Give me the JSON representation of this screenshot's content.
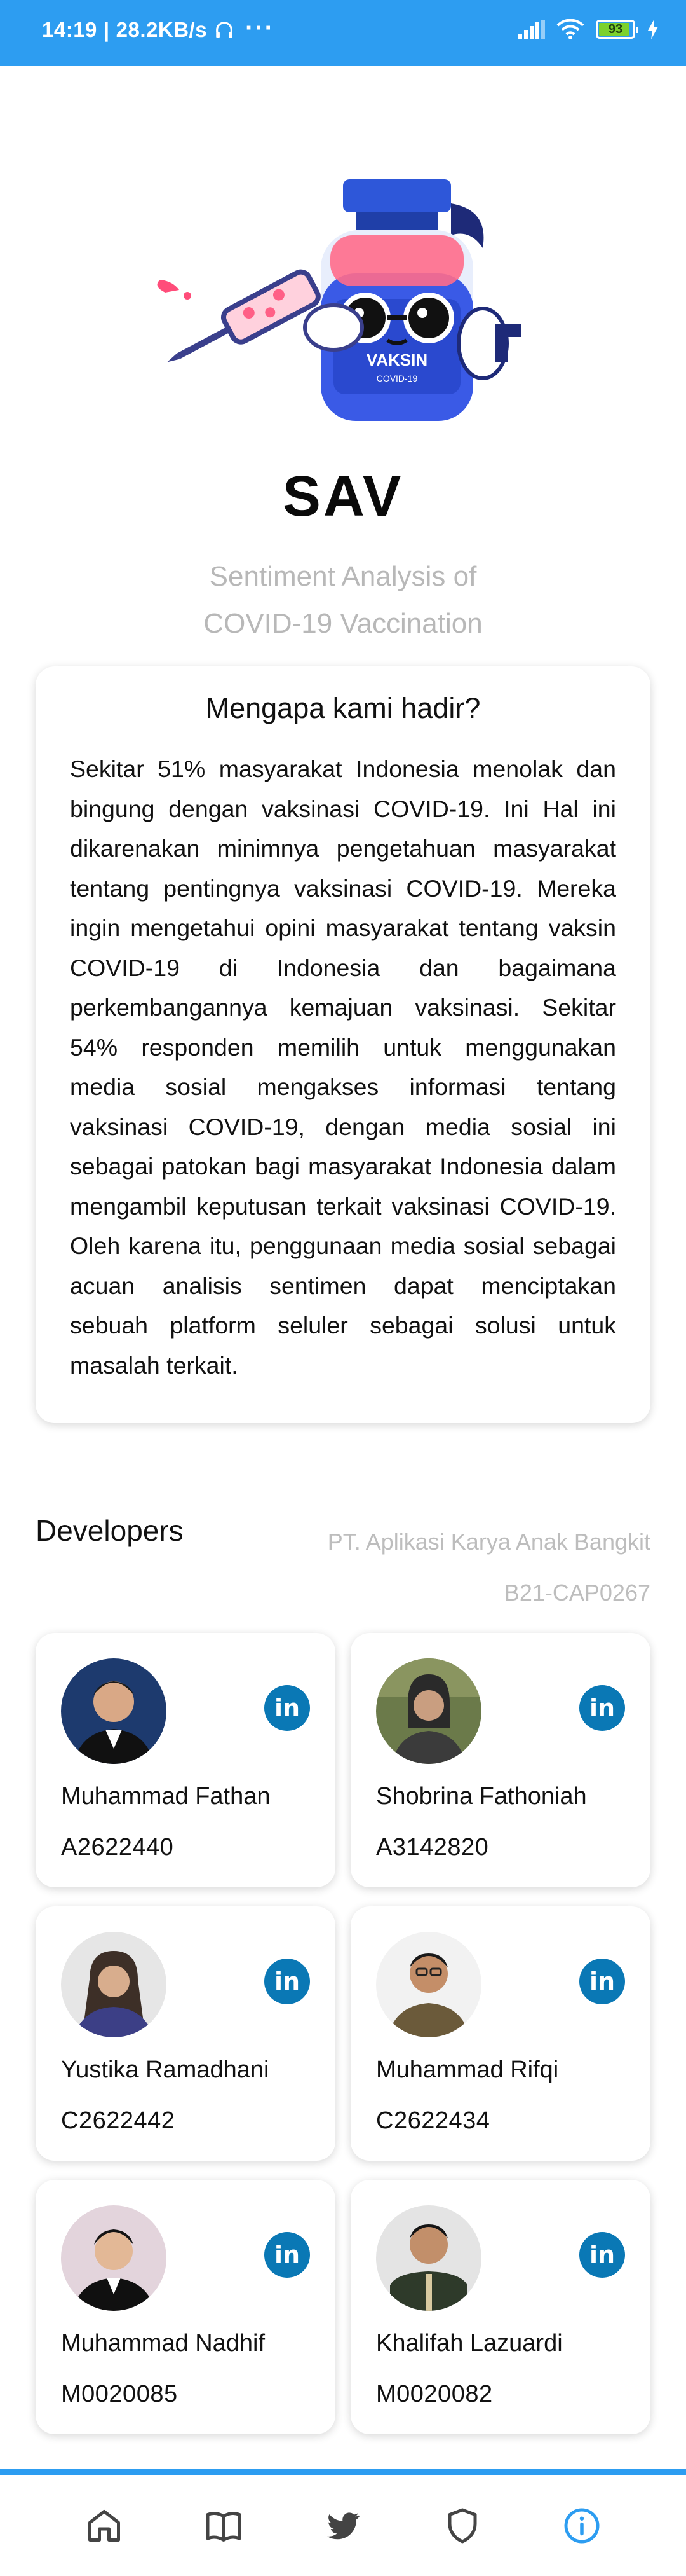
{
  "status_bar": {
    "time": "14:19",
    "net_speed": "28.2KB/s",
    "more": "···",
    "battery": "93"
  },
  "app": {
    "title": "SAV",
    "subtitle_line1": "Sentiment Analysis of",
    "subtitle_line2": "COVID-19 Vaccination",
    "mascot_label": "VAKSIN",
    "mascot_sublabel": "COVID-19"
  },
  "why": {
    "heading": "Mengapa kami hadir?",
    "body": "Sekitar 51% masyarakat Indonesia menolak dan bingung dengan vaksinasi COVID-19. Ini Hal ini dikarenakan minimnya pengetahuan masyarakat tentang pentingnya vaksinasi COVID-19. Mereka ingin mengetahui opini masyarakat tentang vaksin COVID-19 di Indonesia dan bagaimana perkembangannya kemajuan vaksinasi. Sekitar 54% responden memilih untuk menggunakan media sosial mengakses informasi tentang vaksinasi COVID-19, dengan media sosial ini sebagai patokan bagi masyarakat Indonesia dalam mengambil keputusan terkait vaksinasi COVID-19. Oleh karena itu, penggunaan media sosial sebagai acuan analisis sentimen dapat menciptakan sebuah platform seluler sebagai solusi untuk masalah terkait."
  },
  "developers": {
    "title": "Developers",
    "company": "PT. Aplikasi Karya Anak Bangkit",
    "team_id": "B21-CAP0267",
    "linkedin_label": "in",
    "items": [
      {
        "name": "Muhammad Fathan",
        "id": "A2622440"
      },
      {
        "name": "Shobrina Fathoniah",
        "id": "A3142820"
      },
      {
        "name": "Yustika Ramadhani",
        "id": "C2622442"
      },
      {
        "name": "Muhammad Rifqi",
        "id": "C2622434"
      },
      {
        "name": "Muhammad Nadhif",
        "id": "M0020085"
      },
      {
        "name": "Khalifah Lazuardi",
        "id": "M0020082"
      }
    ]
  },
  "bottom_nav": {
    "items": [
      "home-icon",
      "book-icon",
      "twitter-icon",
      "shield-icon",
      "info-icon"
    ],
    "active": "info-icon",
    "active_color": "#2d9df1"
  },
  "colors": {
    "accent": "#2d9df1",
    "linkedin": "#0a78b5"
  }
}
